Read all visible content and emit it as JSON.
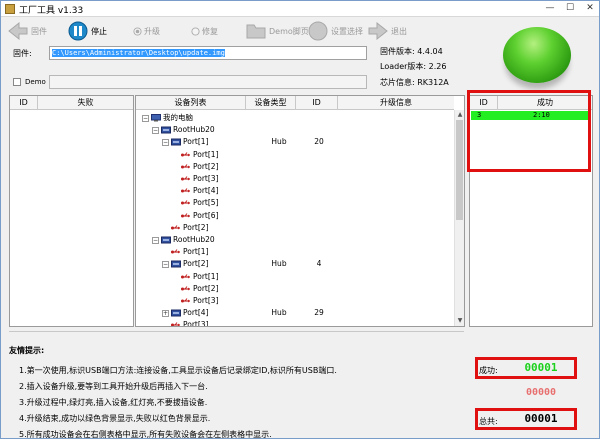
{
  "window": {
    "title": "工厂工具 v1.33"
  },
  "toolbar": {
    "items": [
      {
        "label": "固件"
      },
      {
        "label": "停止"
      },
      {
        "label": "升级"
      },
      {
        "label": "修复"
      },
      {
        "label": "Demo脚页"
      },
      {
        "label": "设置选择"
      },
      {
        "label": "退出"
      }
    ]
  },
  "firmware": {
    "label": "固件:",
    "path": "C:\\Users\\Administrator\\Desktop\\update.img"
  },
  "demo": {
    "label": "Demo"
  },
  "info": {
    "fw_version": "固件版本: 4.4.04",
    "loader_version": "Loader版本: 2.26",
    "chip_info": "芯片信息: RK312A"
  },
  "fail_table": {
    "columns": [
      "ID",
      "失败"
    ]
  },
  "device_tree": {
    "columns": [
      "设备列表",
      "设备类型",
      "ID",
      "升级信息"
    ],
    "rows": [
      {
        "label": "我的电脑",
        "type": "",
        "id": "",
        "depth": 0,
        "icon": "computer-icon",
        "expander": "⊟"
      },
      {
        "label": "RootHub20",
        "type": "",
        "id": "",
        "depth": 1,
        "icon": "hub-icon",
        "expander": "⊟"
      },
      {
        "label": "Port[1]",
        "type": "Hub",
        "id": "20",
        "depth": 2,
        "icon": "hub-icon",
        "expander": "⊟"
      },
      {
        "label": "Port[1]",
        "type": "",
        "id": "",
        "depth": 3,
        "icon": "usb-icon",
        "expander": ""
      },
      {
        "label": "Port[2]",
        "type": "",
        "id": "",
        "depth": 3,
        "icon": "usb-icon",
        "expander": ""
      },
      {
        "label": "Port[3]",
        "type": "",
        "id": "",
        "depth": 3,
        "icon": "usb-icon",
        "expander": ""
      },
      {
        "label": "Port[4]",
        "type": "",
        "id": "",
        "depth": 3,
        "icon": "usb-icon",
        "expander": ""
      },
      {
        "label": "Port[5]",
        "type": "",
        "id": "",
        "depth": 3,
        "icon": "usb-icon",
        "expander": ""
      },
      {
        "label": "Port[6]",
        "type": "",
        "id": "",
        "depth": 3,
        "icon": "usb-icon",
        "expander": ""
      },
      {
        "label": "Port[2]",
        "type": "",
        "id": "",
        "depth": 2,
        "icon": "usb-icon",
        "expander": ""
      },
      {
        "label": "RootHub20",
        "type": "",
        "id": "",
        "depth": 1,
        "icon": "hub-icon",
        "expander": "⊟"
      },
      {
        "label": "Port[1]",
        "type": "",
        "id": "",
        "depth": 2,
        "icon": "usb-icon",
        "expander": ""
      },
      {
        "label": "Port[2]",
        "type": "Hub",
        "id": "4",
        "depth": 2,
        "icon": "hub-icon",
        "expander": "⊟"
      },
      {
        "label": "Port[1]",
        "type": "",
        "id": "",
        "depth": 3,
        "icon": "usb-icon",
        "expander": ""
      },
      {
        "label": "Port[2]",
        "type": "",
        "id": "",
        "depth": 3,
        "icon": "usb-icon",
        "expander": ""
      },
      {
        "label": "Port[3]",
        "type": "",
        "id": "",
        "depth": 3,
        "icon": "usb-icon",
        "expander": ""
      },
      {
        "label": "Port[4]",
        "type": "Hub",
        "id": "29",
        "depth": 2,
        "icon": "hub-icon",
        "expander": "⊞"
      },
      {
        "label": "Port[3]",
        "type": "",
        "id": "",
        "depth": 2,
        "icon": "usb-icon",
        "expander": ""
      }
    ]
  },
  "success_table": {
    "columns": [
      "ID",
      "成功"
    ],
    "rows": [
      {
        "id": "3",
        "time": "2:10"
      }
    ]
  },
  "hints": {
    "title": "友情提示:",
    "items": [
      "1.第一次使用,标识USB端口方法:连接设备,工具显示设备后记录绑定ID,标识所有USB端口.",
      "2.插入设备升级,要等到工具开始升级后再插入下一台.",
      "3.升级过程中,绿灯亮,插入设备,红灯亮,不要拔插设备.",
      "4.升级结束,成功以绿色背景显示,失败以红色背景显示.",
      "5.所有成功设备会在右侧表格中显示,所有失败设备会在左侧表格中显示."
    ]
  },
  "counters": {
    "success_label": "成功:",
    "success_value": "00001",
    "fail_value": "00000",
    "total_label": "总共:",
    "total_value": "00001"
  },
  "colors": {
    "success": "#22ee22",
    "highlight": "#e01010",
    "counter_success": "#1bd11b"
  }
}
